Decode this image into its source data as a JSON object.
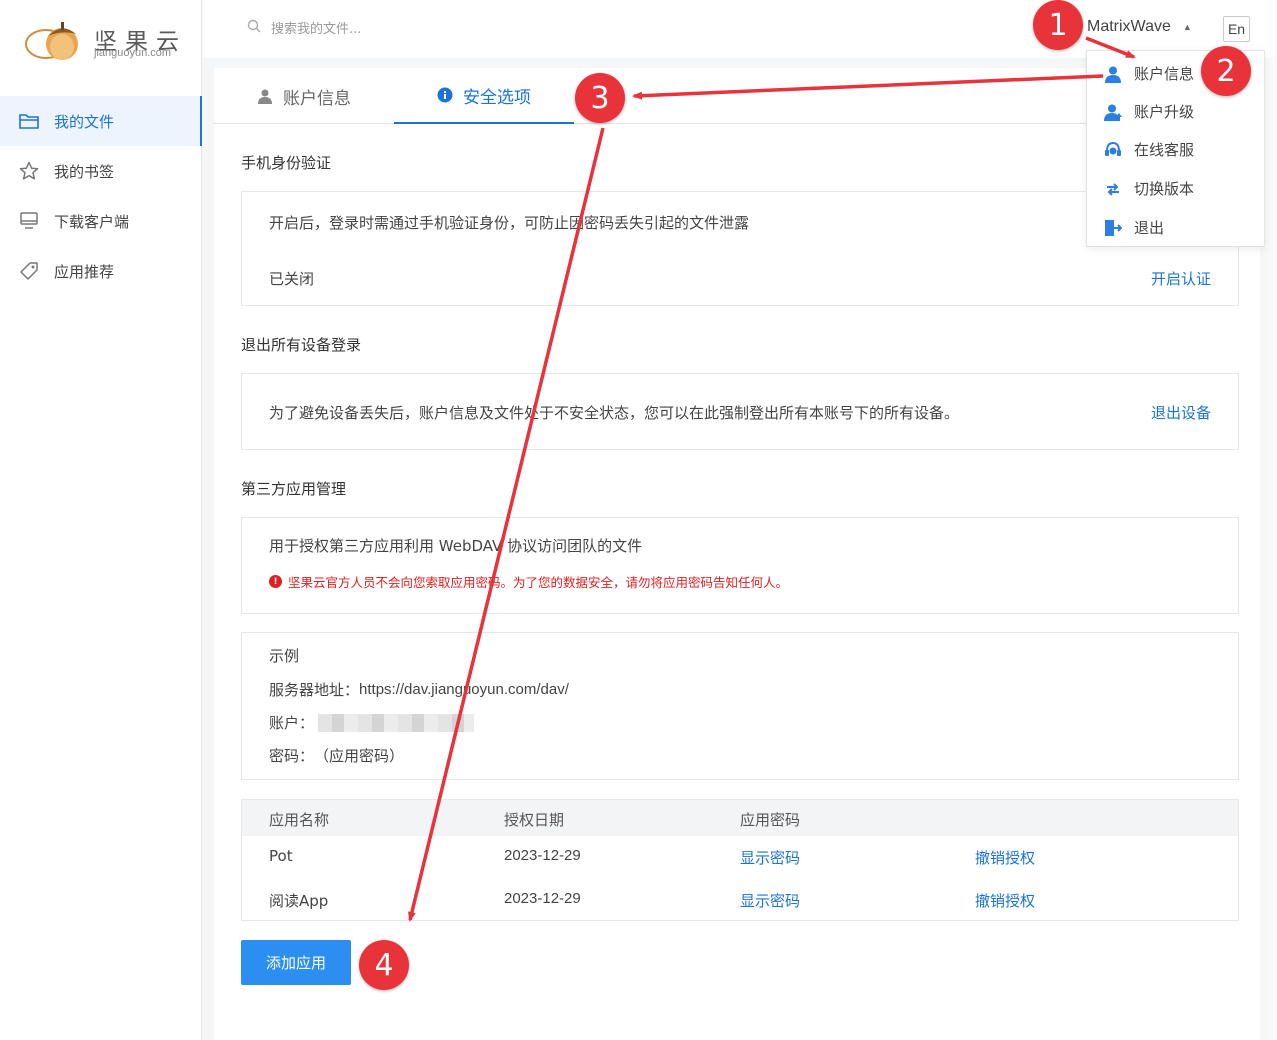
{
  "colors": {
    "accent": "#1a73d9",
    "button": "#2b8ef0",
    "warning": "#e02020",
    "annotation": "#e8333b"
  },
  "logo": {
    "brand": "坚果云",
    "domain": "jianguoyun.com"
  },
  "sidebar": {
    "items": [
      {
        "label": "我的文件",
        "icon": "folder-icon",
        "active": true
      },
      {
        "label": "我的书签",
        "icon": "star-icon",
        "active": false
      },
      {
        "label": "下载客户端",
        "icon": "monitor-icon",
        "active": false
      },
      {
        "label": "应用推荐",
        "icon": "tag-icon",
        "active": false
      }
    ]
  },
  "header": {
    "search_placeholder": "搜索我的文件...",
    "username": "MatrixWave",
    "lang": "En"
  },
  "tabs": [
    {
      "label": "账户信息",
      "icon": "user-icon"
    },
    {
      "label": "安全选项",
      "icon": "info-icon",
      "active": true
    }
  ],
  "phone_auth": {
    "title": "手机身份验证",
    "desc": "开启后，登录时需通过手机验证身份，可防止因密码丢失引起的文件泄露",
    "status": "已关闭",
    "action": "开启认证"
  },
  "logout_devices": {
    "title": "退出所有设备登录",
    "desc": "为了避免设备丢失后，账户信息及文件处于不安全状态，您可以在此强制登出所有本账号下的所有设备。",
    "action": "退出设备"
  },
  "third_party": {
    "title": "第三方应用管理",
    "desc": "用于授权第三方应用利用 WebDAV 协议访问团队的文件",
    "warning": "坚果云官方人员不会向您索取应用密码。为了您的数据安全，请勿将应用密码告知任何人。",
    "example": {
      "title": "示例",
      "server_label": "服务器地址：",
      "server_value": "https://dav.jianguoyun.com/dav/",
      "account_label": "账户：",
      "password_label": "密码：",
      "password_value": "（应用密码）"
    },
    "table": {
      "headers": [
        "应用名称",
        "授权日期",
        "应用密码"
      ],
      "rows": [
        {
          "name": "Pot",
          "date": "2023-12-29",
          "show": "显示密码",
          "revoke": "撤销授权"
        },
        {
          "name": "阅读App",
          "date": "2023-12-29",
          "show": "显示密码",
          "revoke": "撤销授权"
        }
      ]
    },
    "add_button": "添加应用"
  },
  "dropdown": {
    "items": [
      {
        "label": "账户信息",
        "icon": "user-icon"
      },
      {
        "label": "账户升级",
        "icon": "user-upgrade-icon"
      },
      {
        "label": "在线客服",
        "icon": "headset-icon"
      },
      {
        "label": "切换版本",
        "icon": "switch-icon"
      },
      {
        "label": "退出",
        "icon": "logout-icon"
      }
    ]
  },
  "annotations": [
    "1",
    "2",
    "3",
    "4"
  ]
}
